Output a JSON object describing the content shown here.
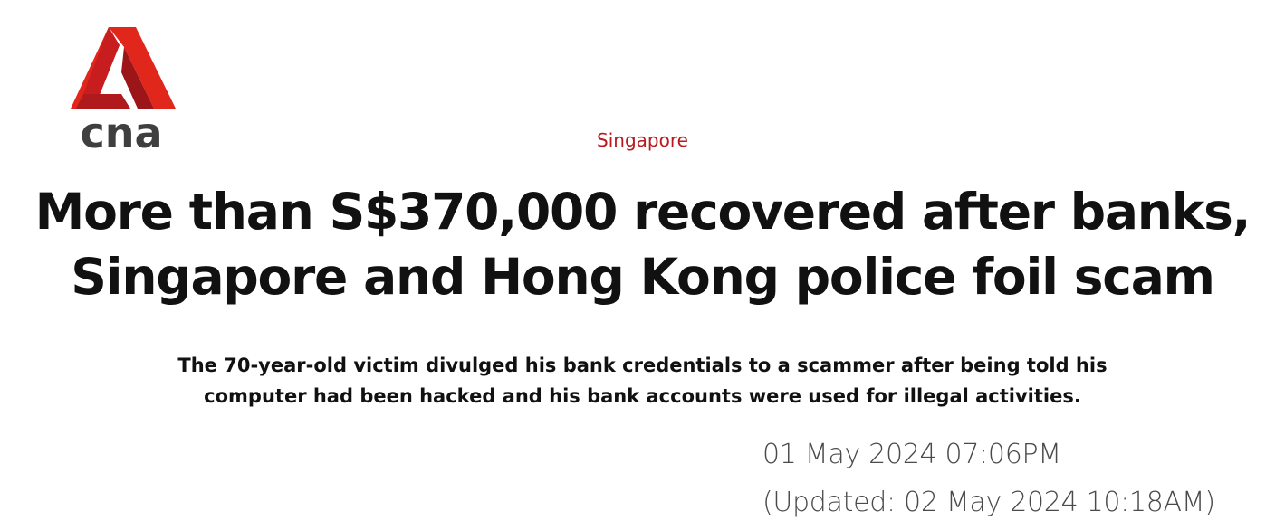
{
  "brand": {
    "logo_text": "cna",
    "logo_colors": {
      "mark_red": "#e1261c",
      "mark_dark_red": "#9c1519",
      "text_gray": "#3f3f3f"
    }
  },
  "article": {
    "category": "Singapore",
    "category_color": "#b81a1f",
    "headline_line1": "More than S$370,000 recovered after banks,",
    "headline_line2": "Singapore and Hong Kong police foil scam",
    "summary_line1": "The 70-year-old victim divulged his bank credentials to a scammer after being told his",
    "summary_line2": "computer had been hacked and his bank accounts were used for illegal activities.",
    "published": "01 May 2024 07:06PM",
    "updated": "(Updated: 02 May 2024 10:18AM)"
  }
}
